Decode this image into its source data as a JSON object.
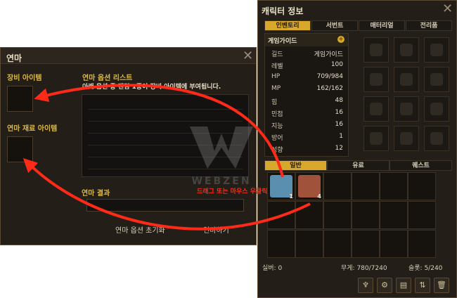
{
  "enchant": {
    "title": "연마",
    "equip_label": "장비 아이템",
    "material_label": "연마 재료 아이템",
    "optlist_title": "연마 옵션 리스트",
    "optlist_desc": "아래 옵션 중 랜덤 1종이 장비 아이템에 부여됩니다.",
    "result_label": "연마 결과",
    "reset_button": "연마 옵션 초기화",
    "enchant_button": "연마하기",
    "close": "✕"
  },
  "hint": "드래그 또는 마우스 우클릭",
  "watermark": "WEBZEN",
  "character": {
    "title": "캐릭터 정보",
    "close": "✕",
    "tabs": [
      "인벤토리",
      "서번트",
      "매터리얼",
      "전리품"
    ],
    "active_tab": 0,
    "name": "게임가이드",
    "stats": [
      {
        "k": "길드",
        "v": "게임가이드"
      },
      {
        "k": "레벨",
        "v": "100"
      },
      {
        "k": "HP",
        "v": "709/984"
      },
      {
        "k": "MP",
        "v": "162/162"
      },
      {
        "k": "힘",
        "v": "48"
      },
      {
        "k": "민첩",
        "v": "16"
      },
      {
        "k": "지능",
        "v": "16"
      },
      {
        "k": "방어",
        "v": "1"
      },
      {
        "k": "성향",
        "v": "12"
      }
    ],
    "inv_tabs": [
      "일반",
      "유료",
      "퀘스트"
    ],
    "active_inv_tab": 0,
    "items": [
      {
        "slot": 0,
        "count": "1",
        "color": "#5b8fb0"
      },
      {
        "slot": 1,
        "count": "4",
        "color": "#a0523a"
      }
    ],
    "silver_label": "실버: 0",
    "weight_label": "무게: 780/7240",
    "slots_label": "슬롯: 5/240",
    "icons": [
      "mount-icon",
      "gear-icon",
      "book-icon",
      "sort-icon",
      "trash-icon"
    ]
  },
  "colors": {
    "arrow": "#ff2a18",
    "accent": "#d8a82c"
  }
}
